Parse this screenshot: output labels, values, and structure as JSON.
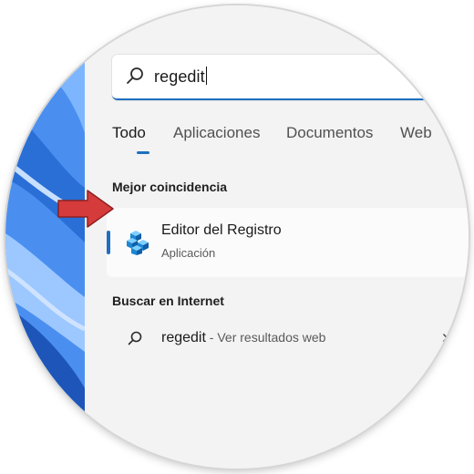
{
  "search": {
    "query": "regedit",
    "icon": "search-icon"
  },
  "tabs": [
    {
      "label": "Todo",
      "active": true
    },
    {
      "label": "Aplicaciones",
      "active": false
    },
    {
      "label": "Documentos",
      "active": false
    },
    {
      "label": "Web",
      "active": false
    }
  ],
  "best_match": {
    "section_title": "Mejor coincidencia",
    "title": "Editor del Registro",
    "subtitle": "Aplicación",
    "icon": "registry-editor-icon"
  },
  "web_search": {
    "section_title": "Buscar en Internet",
    "query": "regedit",
    "suffix": " - Ver resultados web",
    "icon": "search-icon"
  },
  "colors": {
    "accent": "#1e6fbf",
    "panel_bg": "#f3f3f3",
    "arrow": "#d63b3b"
  }
}
